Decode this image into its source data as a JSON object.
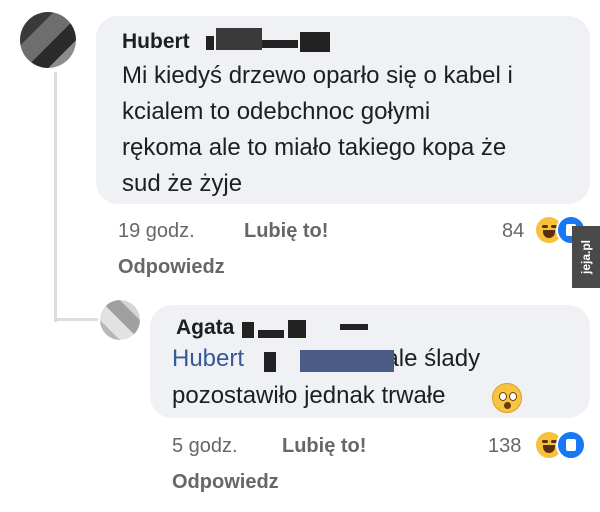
{
  "comment1": {
    "author": "Hubert",
    "lines": [
      "Mi kiedyś drzewo oparło się o kabel i",
      "kcialem to odebchnoc gołymi",
      "rękoma  ale to miało takiego kopa że",
      "sud że żyje"
    ],
    "time": "19 godz.",
    "like_label": "Lubię to!",
    "reply_label": "Odpowiedz",
    "reaction_count": "84",
    "reaction_icons": [
      "haha-icon",
      "like-icon"
    ]
  },
  "comment2": {
    "author": "Agata",
    "mention": "Hubert",
    "text_after_mention": "ale ślady",
    "line2": "pozostawiło jednak trwałe",
    "emoji": "astonished-emoji-icon",
    "time": "5 godz.",
    "like_label": "Lubię to!",
    "reply_label": "Odpowiedz",
    "reaction_count": "138",
    "reaction_icons": [
      "haha-icon",
      "like-icon"
    ]
  },
  "watermark": "jeja.pl",
  "colors": {
    "bubble": "#eff1f4",
    "mention": "#385898",
    "meta": "#65676b",
    "like": "#1877f2",
    "haha": "#f7c23b"
  }
}
